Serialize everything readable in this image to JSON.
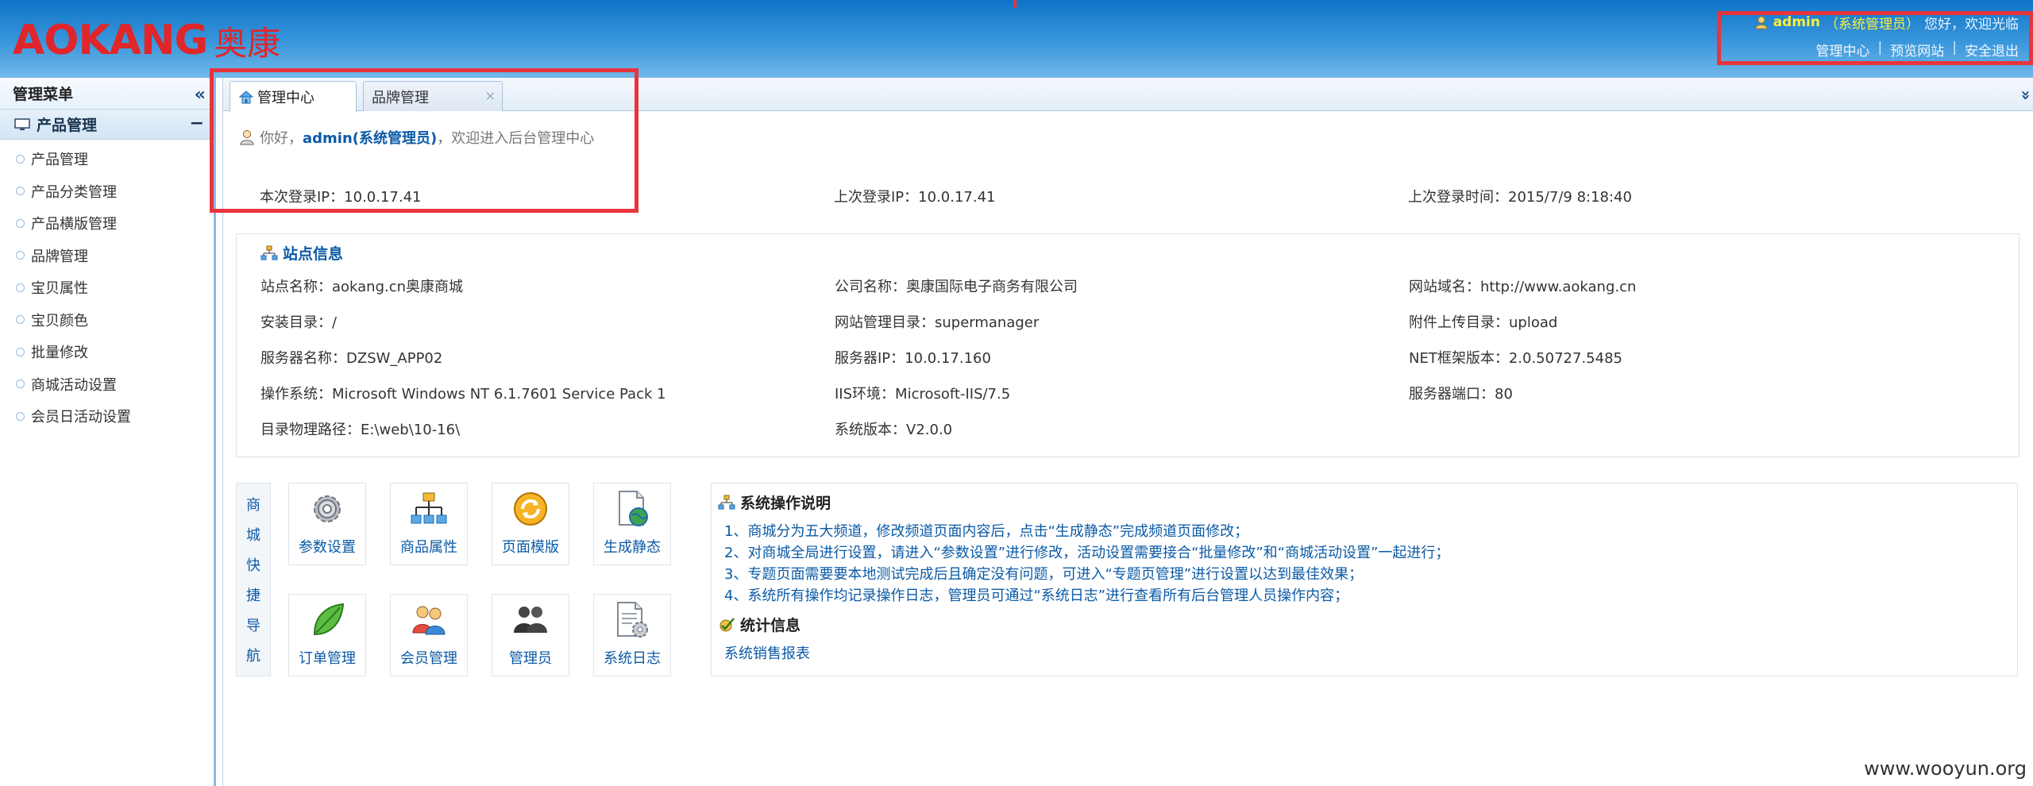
{
  "header": {
    "logo_latin": "AOKANG",
    "logo_cjk": "奥康",
    "user_name": "admin",
    "user_role": "（系统管理员）",
    "greeting": "您好，欢迎光临",
    "links": [
      "管理中心",
      "预览网站",
      "安全退出"
    ],
    "separator": "|"
  },
  "sidebar": {
    "title": "管理菜单",
    "collapse_icon": "«",
    "group_title": "产品管理",
    "group_toggle": "−",
    "items": [
      "产品管理",
      "产品分类管理",
      "产品横版管理",
      "品牌管理",
      "宝贝属性",
      "宝贝颜色",
      "批量修改",
      "商城活动设置",
      "会员日活动设置"
    ]
  },
  "tabs": {
    "active": "管理中心",
    "inactive": "品牌管理",
    "close": "×",
    "menu_icon": "»"
  },
  "welcome": {
    "prefix": "你好，",
    "user": "admin(系统管理员)",
    "suffix": "，欢迎进入后台管理中心"
  },
  "login": {
    "current_ip": "本次登录IP：10.0.17.41",
    "last_ip": "上次登录IP：10.0.17.41",
    "last_time": "上次登录时间：2015/7/9 8:18:40"
  },
  "site_info": {
    "title": "站点信息",
    "rows": [
      [
        "站点名称：aokang.cn奥康商城",
        "公司名称：奥康国际电子商务有限公司",
        "网站域名：http://www.aokang.cn"
      ],
      [
        "安装目录：/",
        "网站管理目录：supermanager",
        "附件上传目录：upload"
      ],
      [
        "服务器名称：DZSW_APP02",
        "服务器IP：10.0.17.160",
        "NET框架版本：2.0.50727.5485"
      ],
      [
        "操作系统：Microsoft Windows NT 6.1.7601 Service Pack 1",
        "IIS环境：Microsoft-IIS/7.5",
        "服务器端口：80"
      ],
      [
        "目录物理路径：E:\\web\\10-16\\",
        "系统版本：V2.0.0",
        ""
      ]
    ]
  },
  "quick_nav": {
    "label_chars": [
      "商",
      "城",
      "快",
      "捷",
      "导",
      "航"
    ],
    "items": [
      {
        "label": "参数设置",
        "icon": "gear-icon"
      },
      {
        "label": "商品属性",
        "icon": "hierarchy-icon"
      },
      {
        "label": "页面模版",
        "icon": "refresh-icon"
      },
      {
        "label": "生成静态",
        "icon": "doc-globe-icon"
      },
      {
        "label": "订单管理",
        "icon": "leaf-icon"
      },
      {
        "label": "会员管理",
        "icon": "members-icon"
      },
      {
        "label": "管理员",
        "icon": "admins-icon"
      },
      {
        "label": "系统日志",
        "icon": "doc-gear-icon"
      }
    ]
  },
  "ops": {
    "title": "系统操作说明",
    "lines": [
      "1、商城分为五大频道，修改频道页面内容后，点击“生成静态”完成频道页面修改；",
      "2、对商城全局进行设置，请进入“参数设置”进行修改，活动设置需要接合“批量修改”和“商城活动设置”一起进行；",
      "3、专题页面需要要本地测试完成后且确定没有问题，可进入“专题页管理”进行设置以达到最佳效果；",
      "4、系统所有操作均记录操作日志，管理员可通过“系统日志”进行查看所有后台管理人员操作内容；"
    ],
    "stats_title": "统计信息",
    "stats_link": "系统销售报表"
  },
  "watermark": "www.wooyun.org",
  "colors": {
    "header_top": "#0f74c6",
    "logo": "#e0262a",
    "link_blue": "#0b5aa6",
    "highlight": "#e8343c"
  }
}
